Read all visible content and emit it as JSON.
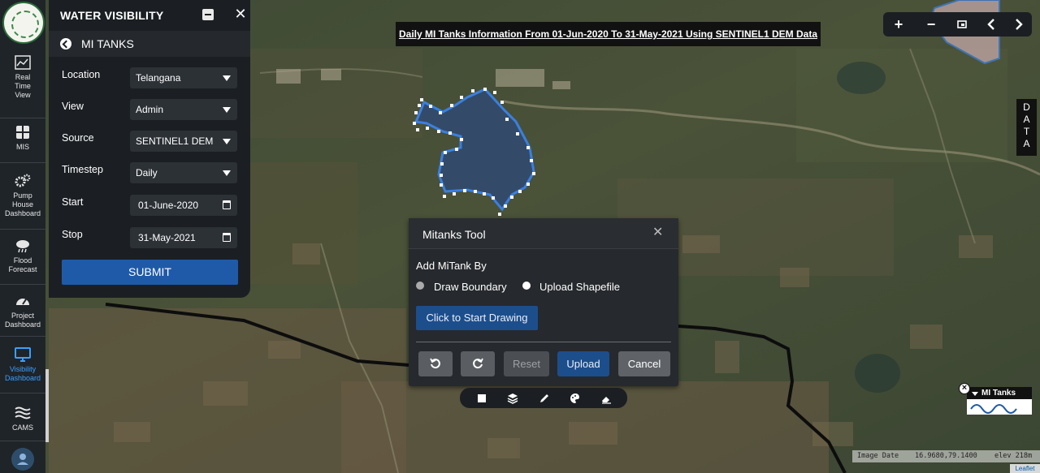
{
  "banner": {
    "text": "Daily MI Tanks Information From 01-Jun-2020 To 31-May-2021 Using SENTINEL1 DEM Data"
  },
  "leftnav": {
    "items": [
      {
        "icon": "chart-icon",
        "label": "Real\nTime\nView"
      },
      {
        "icon": "table-grid-icon",
        "label": "MIS"
      },
      {
        "icon": "gears-icon",
        "label": "Pump\nHouse\nDashboard"
      },
      {
        "icon": "cloud-rain-icon",
        "label": "Flood\nForecast"
      },
      {
        "icon": "speedometer-icon",
        "label": "Project\nDashboard"
      },
      {
        "icon": "monitor-icon",
        "label": "Visibility\nDashboard",
        "active": true
      },
      {
        "icon": "waves-icon",
        "label": "CAMS"
      }
    ]
  },
  "panel": {
    "title": "WATER VISIBILITY",
    "subtitle": "MI TANKS",
    "fields": [
      {
        "label": "Location",
        "value": "Telangana"
      },
      {
        "label": "View",
        "value": "Admin"
      },
      {
        "label": "Source",
        "value": "SENTINEL1 DEM"
      },
      {
        "label": "Timestep",
        "value": "Daily"
      },
      {
        "label": "Start",
        "value": "01-June-2020"
      },
      {
        "label": "Stop",
        "value": "31-May-2021"
      }
    ],
    "submit_label": "SUBMIT"
  },
  "mitanks": {
    "title": "Mitanks Tool",
    "add_label": "Add MiTank By",
    "radio_draw": "Draw Boundary",
    "radio_upload": "Upload Shapefile",
    "selected": "Upload Shapefile",
    "draw_button": "Click to Start Drawing",
    "reset_label": "Reset",
    "upload_label": "Upload",
    "cancel_label": "Cancel"
  },
  "data_tab": {
    "letters": [
      "D",
      "A",
      "T",
      "A"
    ]
  },
  "legend": {
    "title": "MI Tanks"
  },
  "statusbar": {
    "image_date": "Image Date",
    "coords": "16.9680,79.1400",
    "elev": "elev 218m"
  },
  "attribution": "Leaflet",
  "colors": {
    "accent": "#1f5aa8",
    "polygon": "#3b7fe0",
    "panel": "#1b1f23"
  }
}
